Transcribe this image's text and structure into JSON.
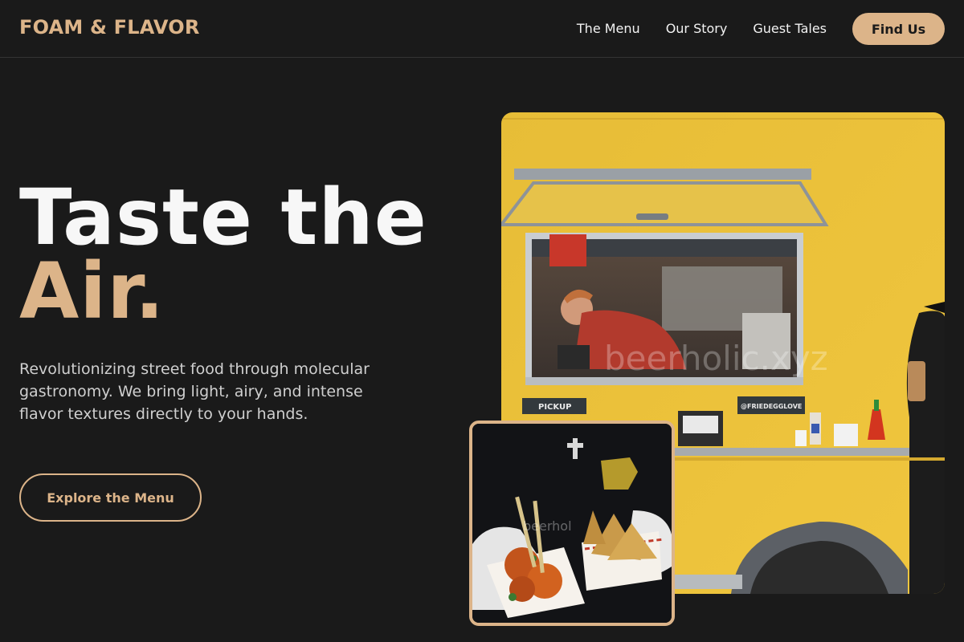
{
  "brand": {
    "name": "FOAM & FLAVOR",
    "accent_color": "#dcb489",
    "background_color": "#1a1a1a"
  },
  "nav": {
    "links": [
      {
        "label": "The Menu"
      },
      {
        "label": "Our Story"
      },
      {
        "label": "Guest Tales"
      }
    ],
    "cta_label": "Find Us"
  },
  "hero": {
    "title_line1": "Taste the",
    "title_line2": "Air.",
    "description": "Revolutionizing street food through molecular gastronomy. We bring light, airy, and intense flavor textures directly to your hands.",
    "button_label": "Explore the Menu"
  },
  "images": {
    "main_watermark": "beerholic.xyz",
    "inset_watermark": "beerhol",
    "window_sign_left": "PICKUP",
    "window_sign_right": "@FRIEDEGGLOVE"
  }
}
